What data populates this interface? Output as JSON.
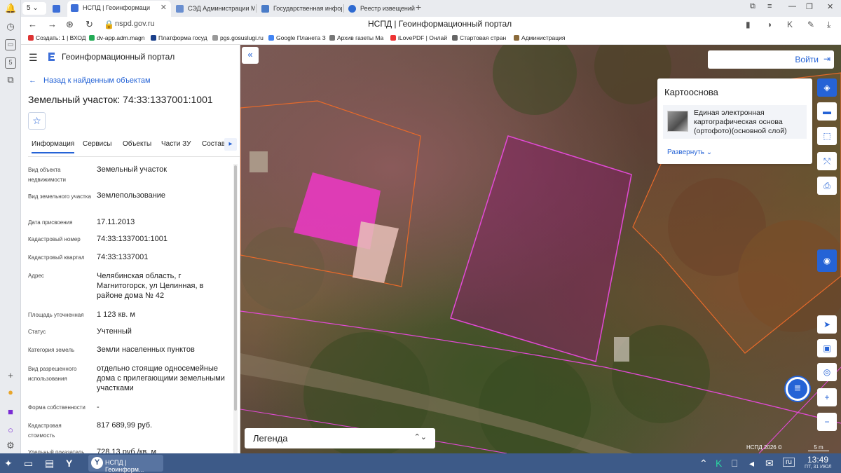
{
  "browser": {
    "tab_count": "5",
    "tabs": [
      {
        "label": "НСПД | Геоинформаци"
      },
      {
        "label": "СЭД Администрации Ма"
      },
      {
        "label": "Государственная инфор"
      },
      {
        "label": "Реестр извещений"
      }
    ],
    "url": "nspd.gov.ru",
    "page_title": "НСПД | Геоинформационный портал",
    "bookmarks": [
      {
        "label": "Создать: 1 | ВХОД",
        "color": "#d33"
      },
      {
        "label": "dv-app.adm.magn",
        "color": "#2a5"
      },
      {
        "label": "Платформа госуд",
        "color": "#1b3f8a"
      },
      {
        "label": "pgs.gosuslugi.ru",
        "color": "#999"
      },
      {
        "label": "Google Планета З",
        "color": "#4285f4"
      },
      {
        "label": "Архив газеты Ма",
        "color": "#777"
      },
      {
        "label": "iLovePDF | Онлай",
        "color": "#e33"
      },
      {
        "label": "Стартовая стран",
        "color": "#666"
      },
      {
        "label": "Администрация",
        "color": "#8a6a3a"
      }
    ]
  },
  "panel": {
    "app_name": "Геоинформационный портал",
    "back_label": "Назад к найденным объектам",
    "title": "Земельный участок: 74:33:1337001:1001",
    "tabs": [
      "Информация",
      "Сервисы",
      "Объекты",
      "Части ЗУ",
      "Состав"
    ],
    "rows": [
      {
        "label": "Вид объекта недвижимости",
        "value": "Земельный участок"
      },
      {
        "label": "Вид земельного участка",
        "value": "Землепользование"
      },
      {
        "label": "Дата присвоения",
        "value": "17.11.2013"
      },
      {
        "label": "Кадастровый номер",
        "value": "74:33:1337001:1001"
      },
      {
        "label": "Кадастровый квартал",
        "value": "74:33:1337001"
      },
      {
        "label": "Адрес",
        "value": "Челябинская область, г Магнитогорск, ул Целинная, в районе дома № 42"
      },
      {
        "label": "Площадь уточненная",
        "value": "1 123 кв. м"
      },
      {
        "label": "Статус",
        "value": "Учтенный"
      },
      {
        "label": "Категория земель",
        "value": "Земли населенных пунктов"
      },
      {
        "label": "Вид разрешенного использования",
        "value": "отдельно стоящие односемейные дома с прилегающими земельными участками"
      },
      {
        "label": "Форма собственности",
        "value": "-"
      },
      {
        "label": "Кадастровая стоимость",
        "value": "817 689,99 руб."
      },
      {
        "label": "Удельный показатель",
        "value": "728,13 руб./кв. м"
      }
    ]
  },
  "map": {
    "login_label": "Войти",
    "basemap_title": "Картооснова",
    "basemap_layer": "Единая электронная картографическая основа (ортофото)(основной слой)",
    "expand_label": "Развернуть",
    "legend_label": "Легенда",
    "copyright": "НСПД 2026 ©",
    "scale": "5 m"
  },
  "taskbar": {
    "app_label": "НСПД | Геоинформ...",
    "lang": "ru",
    "time": "13:49",
    "date": "ПТ, 31 ИЮЛ"
  }
}
